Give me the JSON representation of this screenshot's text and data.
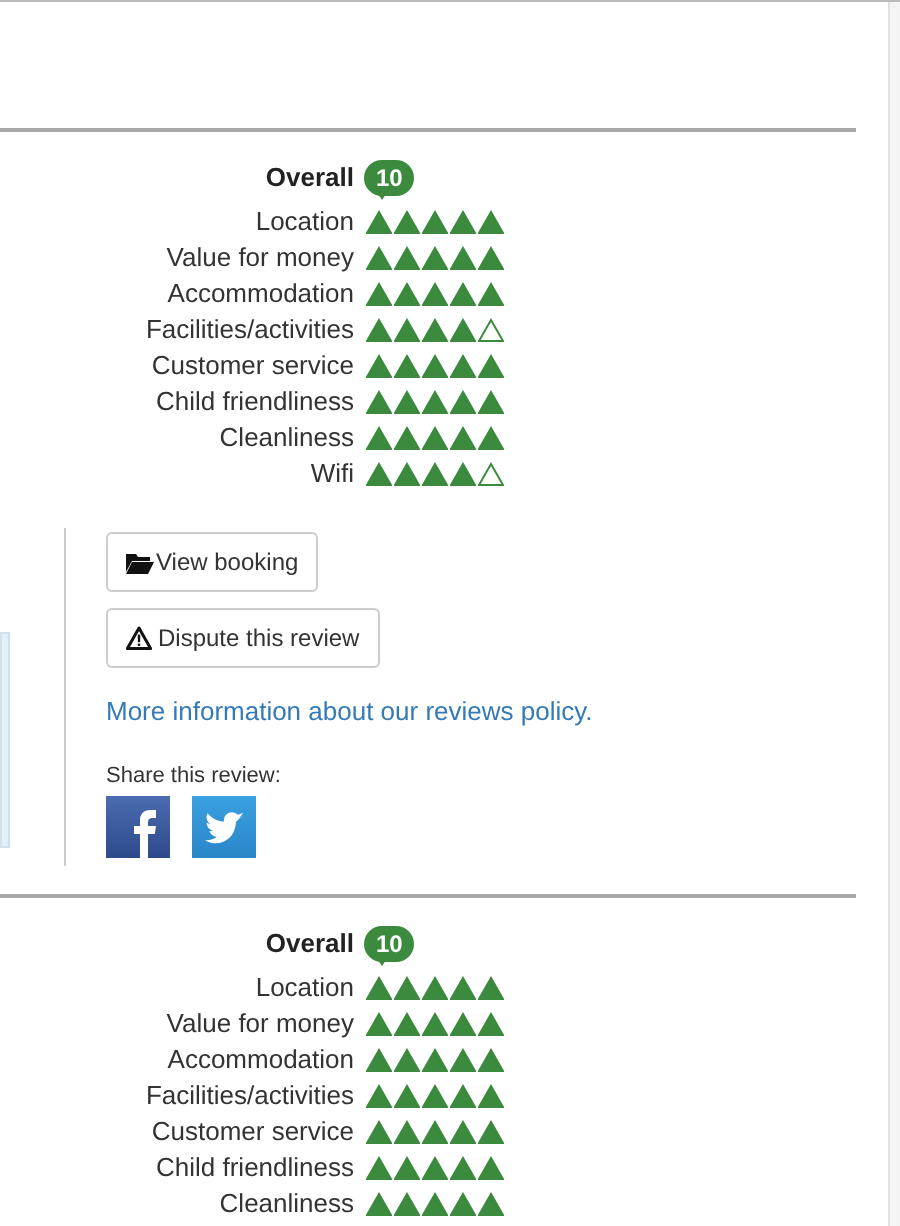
{
  "reviews": [
    {
      "overall_label": "Overall",
      "score": "10",
      "ratings": [
        {
          "label": "Location",
          "stars": 5
        },
        {
          "label": "Value for money",
          "stars": 5
        },
        {
          "label": "Accommodation",
          "stars": 5
        },
        {
          "label": "Facilities/activities",
          "stars": 4
        },
        {
          "label": "Customer service",
          "stars": 5
        },
        {
          "label": "Child friendliness",
          "stars": 5
        },
        {
          "label": "Cleanliness",
          "stars": 5
        },
        {
          "label": "Wifi",
          "stars": 4
        }
      ],
      "buttons": [
        {
          "kind": "folder",
          "label": "View booking"
        },
        {
          "kind": "warning",
          "label": "Dispute this review"
        }
      ],
      "policy_link": "More information about our reviews policy.",
      "share_label": "Share this review:",
      "share_icons": [
        {
          "kind": "facebook"
        },
        {
          "kind": "twitter"
        }
      ]
    },
    {
      "overall_label": "Overall",
      "score": "10",
      "ratings": [
        {
          "label": "Location",
          "stars": 5
        },
        {
          "label": "Value for money",
          "stars": 5
        },
        {
          "label": "Accommodation",
          "stars": 5
        },
        {
          "label": "Facilities/activities",
          "stars": 5
        },
        {
          "label": "Customer service",
          "stars": 5
        },
        {
          "label": "Child friendliness",
          "stars": 5
        },
        {
          "label": "Cleanliness",
          "stars": 5
        }
      ]
    }
  ]
}
